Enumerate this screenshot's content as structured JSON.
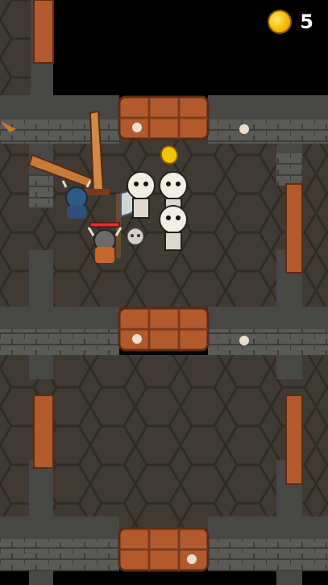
{
  "hud": {
    "coins": "5",
    "coin_icon": "gold-coin-icon"
  },
  "colors": {
    "floor": "#3f3a33",
    "floor_tile_line": "#2e2a24",
    "wall_top": "#4a4a49",
    "wall_face": "#5d5d5a",
    "wood_door": "#b25a2e",
    "coin": "#f5c400"
  },
  "scene": {
    "player": "viking-hero",
    "ally": "blue-knight",
    "enemies": [
      "skeleton-warrior",
      "skeleton-warrior",
      "skeleton-warrior"
    ],
    "items": [
      "gold-coin",
      "skull-drop"
    ]
  }
}
